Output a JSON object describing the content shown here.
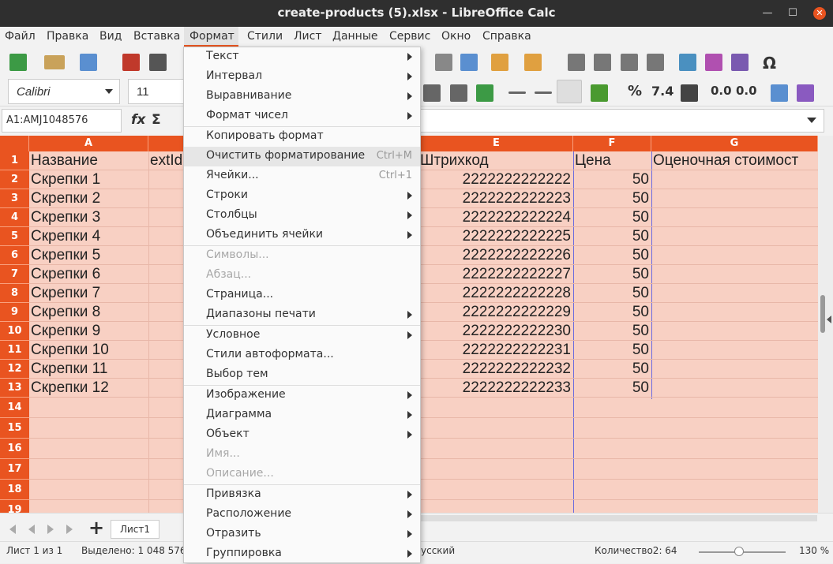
{
  "window": {
    "title": "create-products (5).xlsx - LibreOffice Calc"
  },
  "menubar": [
    "Файл",
    "Правка",
    "Вид",
    "Вставка",
    "Формат",
    "Стили",
    "Лист",
    "Данные",
    "Сервис",
    "Окно",
    "Справка"
  ],
  "font": {
    "name": "Calibri",
    "size": "11"
  },
  "formula": {
    "namebox": "A1:AMJ1048576"
  },
  "columns": [
    "A",
    "",
    "",
    "",
    "E",
    "F",
    "G"
  ],
  "rows": [
    "1",
    "2",
    "3",
    "4",
    "5",
    "6",
    "7",
    "8",
    "9",
    "10",
    "11",
    "12",
    "13",
    "14",
    "15",
    "16",
    "17",
    "18",
    "19"
  ],
  "sheet": {
    "header": {
      "a": "Название",
      "b": "extId",
      "e": "Штрихкод",
      "f": "Цена",
      "g": "Оценочная стоимост"
    },
    "names": [
      "Скрепки 1",
      "Скрепки 2",
      "Скрепки 3",
      "Скрепки 4",
      "Скрепки 5",
      "Скрепки 6",
      "Скрепки 7",
      "Скрепки 8",
      "Скрепки 9",
      "Скрепки 10",
      "Скрепки 11",
      "Скрепки 12"
    ],
    "barcodes": [
      "2222222222222",
      "2222222222223",
      "2222222222224",
      "2222222222225",
      "2222222222226",
      "2222222222227",
      "2222222222228",
      "2222222222229",
      "2222222222230",
      "2222222222231",
      "2222222222232",
      "2222222222233"
    ],
    "prices": [
      "50",
      "50",
      "50",
      "50",
      "50",
      "50",
      "50",
      "50",
      "50",
      "50",
      "50",
      "50"
    ]
  },
  "menu": {
    "items": [
      {
        "label": "Текст",
        "sub": true
      },
      {
        "label": "Интервал",
        "sub": true
      },
      {
        "label": "Выравнивание",
        "sub": true
      },
      {
        "label": "Формат чисел",
        "sub": true
      },
      {
        "label": "Копировать формат"
      },
      {
        "label": "Очистить форматирование",
        "shortcut": "Ctrl+M",
        "highlight": true
      },
      {
        "label": "Ячейки...",
        "shortcut": "Ctrl+1"
      },
      {
        "label": "Строки",
        "sub": true
      },
      {
        "label": "Столбцы",
        "sub": true
      },
      {
        "label": "Объединить ячейки",
        "sub": true
      },
      {
        "label": "Символы...",
        "disabled": true
      },
      {
        "label": "Абзац...",
        "disabled": true
      },
      {
        "label": "Страница..."
      },
      {
        "label": "Диапазоны печати",
        "sub": true
      },
      {
        "label": "Условное",
        "sub": true
      },
      {
        "label": "Стили автоформата..."
      },
      {
        "label": "Выбор тем"
      },
      {
        "label": "Изображение",
        "sub": true
      },
      {
        "label": "Диаграмма",
        "sub": true
      },
      {
        "label": "Объект",
        "sub": true
      },
      {
        "label": "Имя...",
        "disabled": true
      },
      {
        "label": "Описание...",
        "disabled": true
      },
      {
        "label": "Привязка",
        "sub": true
      },
      {
        "label": "Расположение",
        "sub": true
      },
      {
        "label": "Отразить",
        "sub": true
      },
      {
        "label": "Группировка",
        "sub": true
      }
    ]
  },
  "sheettab": {
    "label": "Лист1"
  },
  "status": {
    "sheet": "Лист 1 из 1",
    "selected": "Выделено: 1 048 576 с",
    "lang": "усский",
    "count": "Количество2: 64",
    "zoom": "130 %"
  },
  "colors": {
    "accent": "#e95420",
    "cellbg": "#f8d0c3"
  }
}
